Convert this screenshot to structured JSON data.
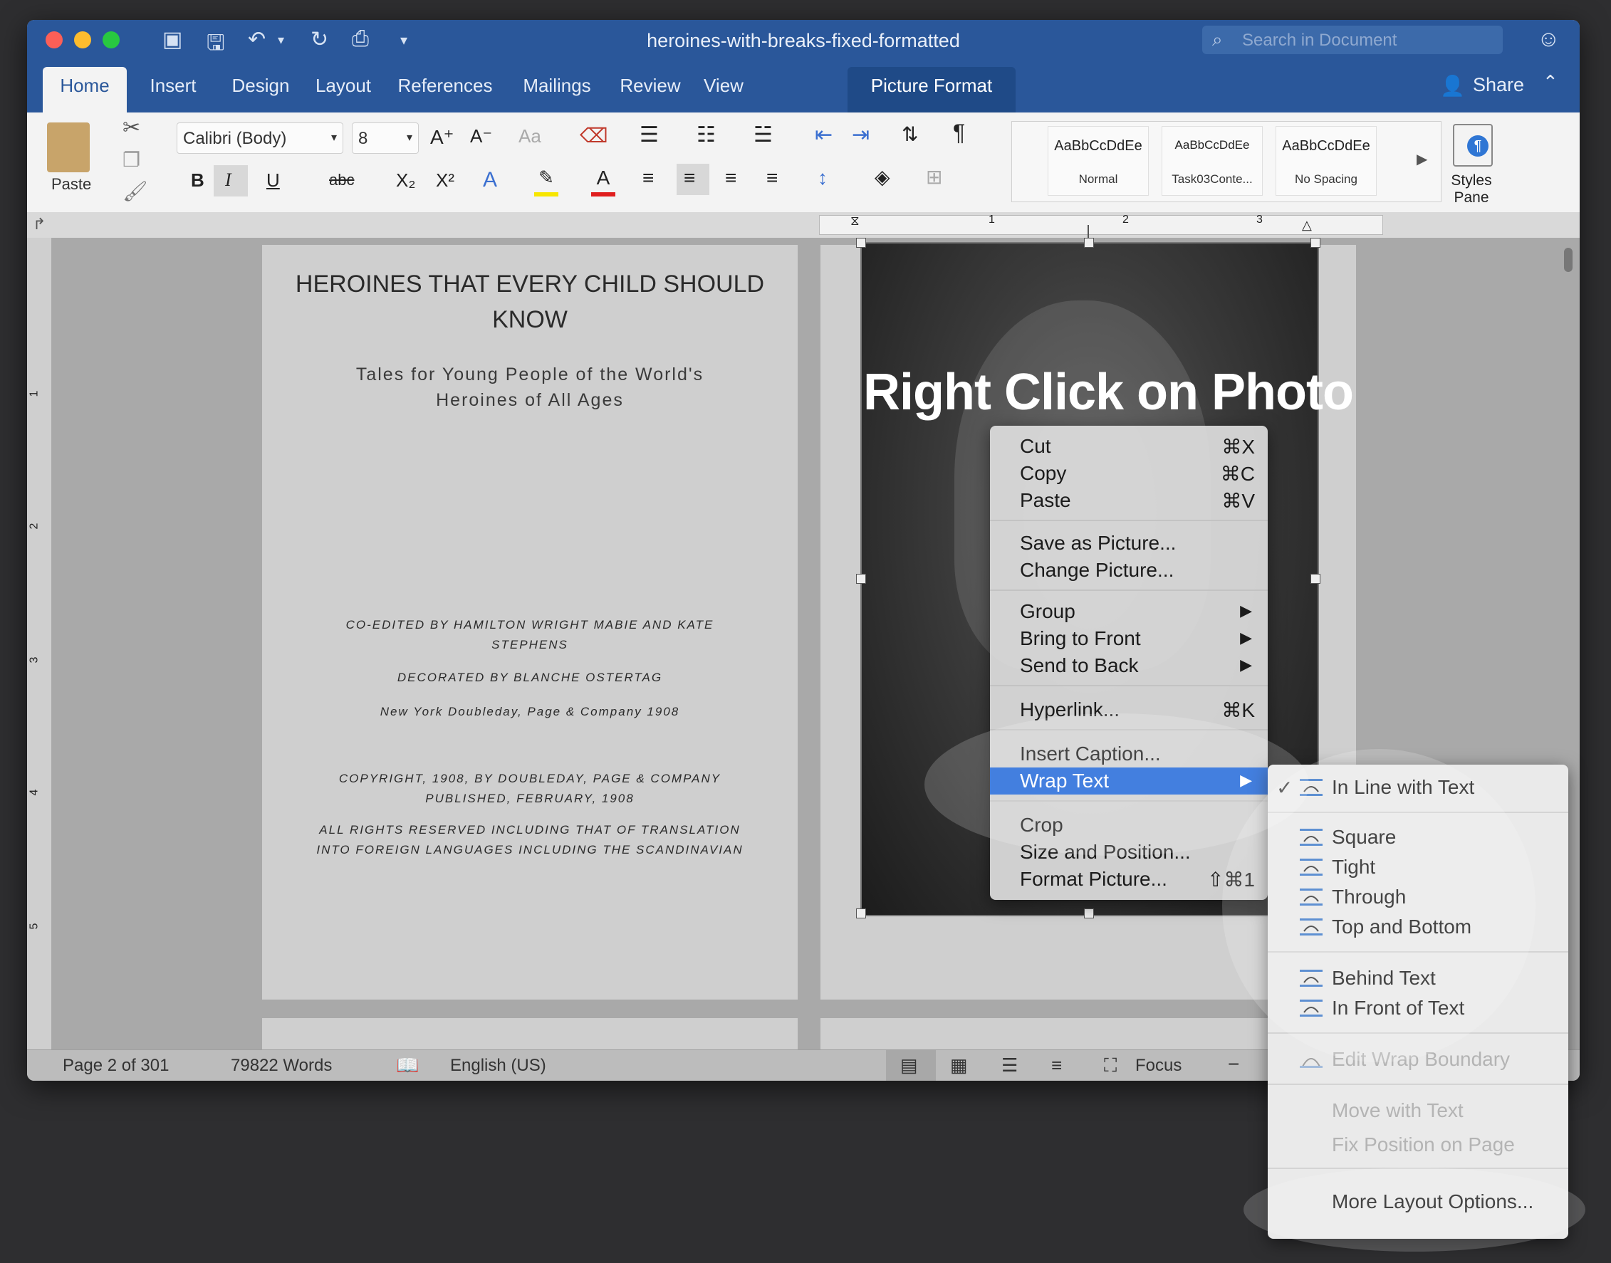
{
  "window": {
    "title": "heroines-with-breaks-fixed-formatted",
    "search_placeholder": "Search in Document",
    "share_label": "Share"
  },
  "tabs": [
    {
      "label": "Home"
    },
    {
      "label": "Insert"
    },
    {
      "label": "Design"
    },
    {
      "label": "Layout"
    },
    {
      "label": "References"
    },
    {
      "label": "Mailings"
    },
    {
      "label": "Review"
    },
    {
      "label": "View"
    },
    {
      "label": "Picture Format"
    }
  ],
  "ribbon": {
    "paste_label": "Paste",
    "font_name": "Calibri (Body)",
    "font_size": "8",
    "bold": "B",
    "italic": "I",
    "underline": "U",
    "strike": "abc",
    "styles": [
      {
        "sample": "AaBbCcDdEe",
        "name": "Normal"
      },
      {
        "sample": "AaBbCcDdEe",
        "name": "Task03Conte..."
      },
      {
        "sample": "AaBbCcDdEe",
        "name": "No Spacing"
      }
    ],
    "styles_pane_label": "Styles\nPane"
  },
  "ruler": {
    "ticks": [
      "1",
      "2",
      "3"
    ],
    "vertical_ticks": [
      "1",
      "2",
      "3",
      "4",
      "5"
    ]
  },
  "page": {
    "title_line1": "HEROINES THAT EVERY CHILD SHOULD",
    "title_line2": "KNOW",
    "subtitle_line1": "Tales for Young People of the World's",
    "subtitle_line2": "Heroines of All Ages",
    "coedited_line1": "CO-EDITED BY HAMILTON WRIGHT MABIE AND KATE",
    "coedited_line2": "STEPHENS",
    "decorated": "DECORATED BY BLANCHE OSTERTAG",
    "publisher": "New York Doubleday, Page & Company 1908",
    "copyright_line1": "COPYRIGHT, 1908, BY DOUBLEDAY, PAGE & COMPANY",
    "copyright_line2": "PUBLISHED, FEBRUARY, 1908",
    "rights_line1": "ALL RIGHTS RESERVED INCLUDING THAT OF TRANSLATION",
    "rights_line2": "INTO FOREIGN LANGUAGES INCLUDING THE SCANDINAVIAN"
  },
  "overlay_title": "Right Click on Photo",
  "context_menu": {
    "items": [
      {
        "label": "Cut",
        "shortcut": "⌘X"
      },
      {
        "label": "Copy",
        "shortcut": "⌘C"
      },
      {
        "label": "Paste",
        "shortcut": "⌘V"
      },
      {
        "label": "Save as Picture..."
      },
      {
        "label": "Change Picture..."
      },
      {
        "label": "Group",
        "submenu": "▶"
      },
      {
        "label": "Bring to Front",
        "submenu": "▶"
      },
      {
        "label": "Send to Back",
        "submenu": "▶"
      },
      {
        "label": "Hyperlink...",
        "shortcut": "⌘K"
      },
      {
        "label": "Insert Caption..."
      },
      {
        "label": "Wrap Text",
        "submenu": "▶"
      },
      {
        "label": "Crop"
      },
      {
        "label": "Size and Position..."
      },
      {
        "label": "Format Picture...",
        "shortcut": "⇧⌘1"
      }
    ]
  },
  "wrap_submenu": {
    "checkmark": "✓",
    "items": [
      {
        "label": "In Line with Text",
        "checked": true
      },
      {
        "label": "Square"
      },
      {
        "label": "Tight"
      },
      {
        "label": "Through"
      },
      {
        "label": "Top and Bottom"
      },
      {
        "label": "Behind Text"
      },
      {
        "label": "In Front of Text"
      },
      {
        "label": "Edit Wrap Boundary",
        "disabled": true
      },
      {
        "label": "Move with Text",
        "disabled": true
      },
      {
        "label": "Fix Position on Page",
        "disabled": true
      },
      {
        "label": "More Layout Options..."
      }
    ]
  },
  "status": {
    "page": "Page 2 of 301",
    "words": "79822 Words",
    "language": "English (US)",
    "focus": "Focus"
  },
  "colors": {
    "title_bar": "#2a579a",
    "menu_highlight": "#1a63d8"
  }
}
